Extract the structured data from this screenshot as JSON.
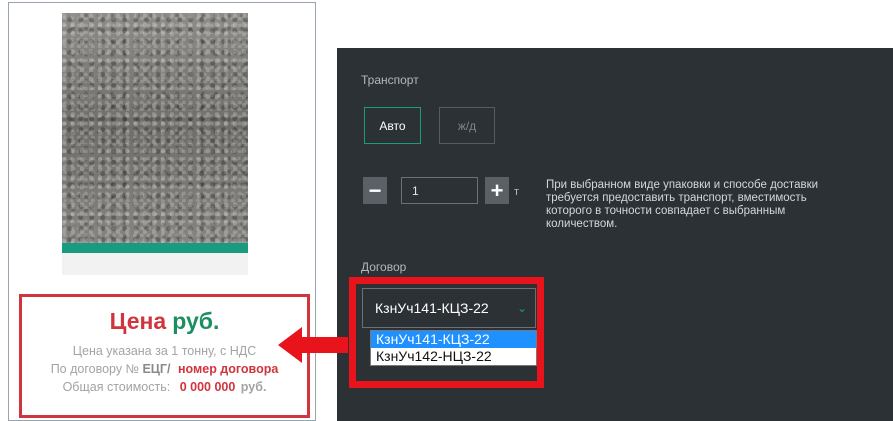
{
  "product": {
    "price_word": "Цена",
    "price_unit": "руб.",
    "note_price": "Цена указана за 1 тонну, с НДС",
    "contract_prefix": "По договору №",
    "contract_code": "ЕЦГ/",
    "contract_number": "номер договора",
    "total_label": "Общая стоимость:",
    "total_value": "0 000 000",
    "total_unit": "руб."
  },
  "transport": {
    "label": "Транспорт",
    "options": [
      "Авто",
      "ж/д"
    ],
    "selected": "Авто"
  },
  "quantity": {
    "minus": "−",
    "plus": "+",
    "value": "1",
    "unit": "т",
    "note": "При выбранном виде упаковки и способе доставки требуется предоставить транспорт, вместимость которого в точности совпадает с выбранным количеством."
  },
  "contract": {
    "label": "Договор",
    "selected": "КзнУч141-КЦЗ-22",
    "options": [
      "КзнУч141-КЦЗ-22",
      "КзнУч142-НЦЗ-22"
    ]
  },
  "colors": {
    "accent": "#1a9a7e",
    "highlight": "#e8131b",
    "panel": "#2c3136",
    "price_red": "#d0343d",
    "price_green": "#1a8f5f"
  }
}
